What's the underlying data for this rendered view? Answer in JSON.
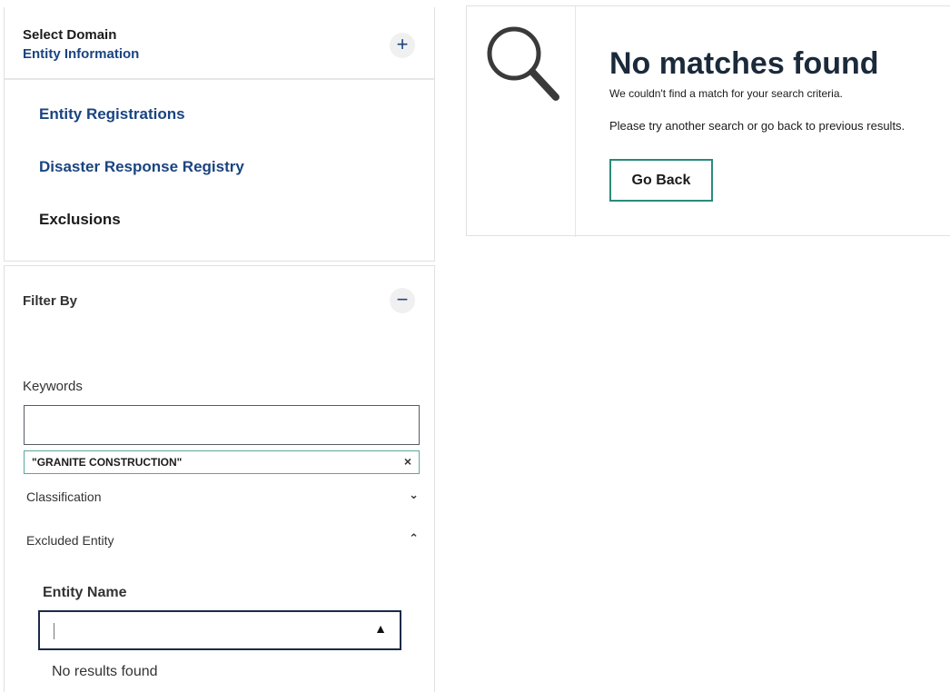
{
  "domain": {
    "title": "Select Domain",
    "subtitle": "Entity Information",
    "expand_symbol": "+",
    "links": [
      {
        "label": "Entity Registrations"
      },
      {
        "label": "Disaster Response Registry"
      },
      {
        "label": "Exclusions"
      }
    ]
  },
  "filter": {
    "title": "Filter By",
    "collapse_symbol": "−",
    "keywords": {
      "label": "Keywords",
      "value": "",
      "chip": "\"GRANITE CONSTRUCTION\"",
      "chip_remove": "×"
    },
    "classification": {
      "label": "Classification",
      "chevron": "⌄"
    },
    "excluded_entity": {
      "label": "Excluded Entity",
      "chevron": "⌃"
    },
    "entity_name": {
      "label": "Entity Name",
      "value": "",
      "arrow": "▲",
      "no_results": "No results found"
    }
  },
  "results": {
    "icon": "search-icon",
    "title": "No matches found",
    "line1": "We couldn't find a match for your search criteria.",
    "line2": "Please try another search or go back to previous results.",
    "button": "Go Back"
  },
  "colors": {
    "link": "#1a4480",
    "chip_border": "#5aa79c",
    "go_back_border": "#2a8a7c",
    "combo_border": "#1b2a4a"
  }
}
